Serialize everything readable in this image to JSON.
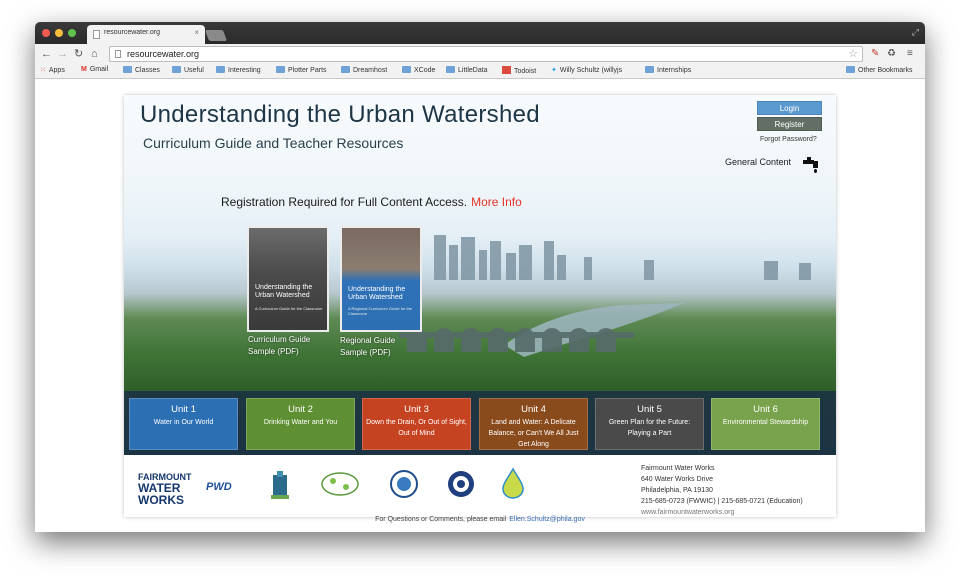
{
  "browser": {
    "tab_title": "resourcewater.org",
    "tab_close": "×",
    "url": "resourcewater.org",
    "bookmarks": [
      "Apps",
      "Gmail",
      "Classes",
      "Useful",
      "Interesting",
      "Plotter Parts",
      "Dreamhost",
      "XCode",
      "LittleData",
      "Todoist",
      "Willy Schultz (willyjs",
      "Internships"
    ],
    "other_bookmarks": "Other Bookmarks"
  },
  "header": {
    "title": "Understanding the Urban Watershed",
    "subtitle": "Curriculum Guide and Teacher Resources",
    "login": "Login",
    "register": "Register",
    "forgot": "Forgot Password?",
    "general_content": "General Content"
  },
  "registration": {
    "text": "Registration Required for Full Content Access.",
    "link": "More Info"
  },
  "guides": [
    {
      "cover_title": "Understanding the Urban Watershed",
      "cover_sub": "A Curriculum Guide for the Classroom",
      "caption_line1": "Curriculum Guide",
      "caption_line2": "Sample (PDF)"
    },
    {
      "cover_title": "Understanding the Urban Watershed",
      "cover_sub": "A Regional Curriculum Guide for the Classroom",
      "caption_line1": "Regional Guide",
      "caption_line2": "Sample (PDF)"
    }
  ],
  "units": [
    {
      "name": "Unit 1",
      "desc": "Water in Our World",
      "color": "#2c6fb3"
    },
    {
      "name": "Unit 2",
      "desc": "Drinking Water and You",
      "color": "#5f8f33"
    },
    {
      "name": "Unit 3",
      "desc": "Down the Drain, Or Out of Sight, Out of Mind",
      "color": "#c64322"
    },
    {
      "name": "Unit 4",
      "desc": "Land and Water: A Delicate Balance, or Can't We All Just Get Along",
      "color": "#8a4b1c"
    },
    {
      "name": "Unit 5",
      "desc": "Green Plan for the Future: Playing a Part",
      "color": "#4a4a4a"
    },
    {
      "name": "Unit 6",
      "desc": "Environmental Stewardship",
      "color": "#78a34c"
    }
  ],
  "footer": {
    "fww_line1": "FAIRMOUNT",
    "fww_line2": "WATER",
    "fww_line3": "WORKS",
    "pwd": "PWD",
    "address": [
      "Fairmount Water Works",
      "640 Water Works Drive",
      "Philadelphia, PA 19130",
      "215-685-0723 (FWWIC) | 215-685-0721 (Education)"
    ],
    "website": "www.fairmountwaterworks.org",
    "contact_text": "For Questions or Comments, please email",
    "contact_email": "Ellen.Schultz@phila.gov"
  }
}
